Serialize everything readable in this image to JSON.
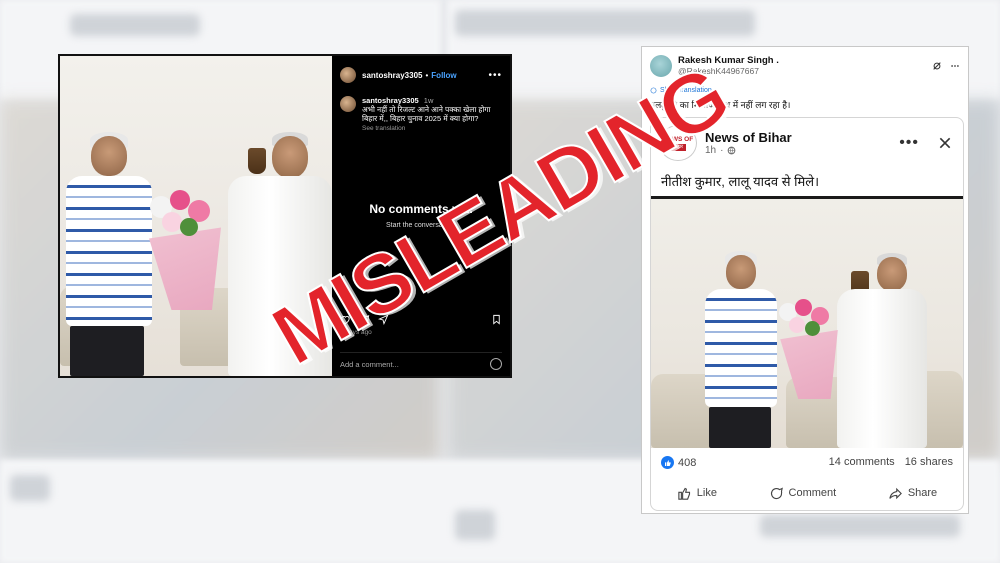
{
  "stamp": {
    "text": "MISLEADING",
    "color": "#e3242b"
  },
  "instagram": {
    "username": "santoshray3305",
    "follow_label": "Follow",
    "caption_username": "santoshray3305",
    "caption_age": "1w",
    "caption_text": "अभी नहीं तो रिजल्ट आने आने पक्का खेला होगा बिहार में,, बिहार चुनाव 2025 में क्या होगा?",
    "see_translation": "See translation",
    "no_comments": "No comments yet.",
    "start_conversation": "Start the conversation.",
    "days_ago": "7 days ago",
    "add_comment_placeholder": "Add a comment...",
    "accent": "#4aa3ff"
  },
  "x_post": {
    "name": "Rakesh Kumar Singh .",
    "handle": "@RakeshK44967667",
    "show_translation": "Show translation",
    "text": "पलटू जी का मिजाज हाथ में नहीं लग रहा है।",
    "embedded": {
      "page_name": "News of Bihar",
      "logo_top": "NEWS OF",
      "logo_bottom": "बिहार",
      "time": "1h",
      "post_text": "नीतीश कुमार, लालू यादव से मिले।",
      "reactions_count": "408",
      "comments": "14 comments",
      "shares": "16 shares",
      "like_label": "Like",
      "comment_label": "Comment",
      "share_label": "Share",
      "brand_color": "#1877f2"
    }
  }
}
